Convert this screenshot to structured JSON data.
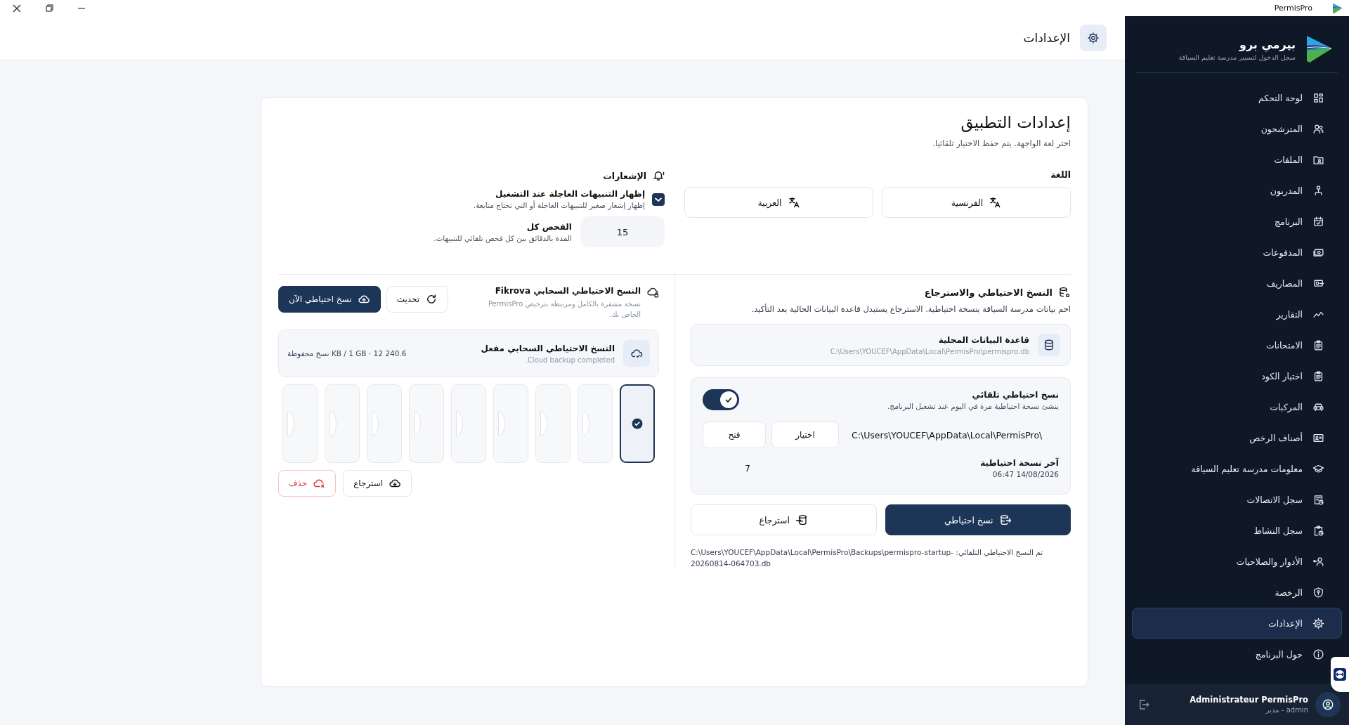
{
  "titlebar": {
    "app_name": "PermisPro"
  },
  "sidebar": {
    "brand": "بيرمي برو",
    "tagline": "سجل الدخول لتسيير مدرسة تعليم السياقة",
    "items": [
      {
        "label": "لوحة التحكم",
        "selected": false
      },
      {
        "label": "المترشحون",
        "selected": false
      },
      {
        "label": "الملفات",
        "selected": false
      },
      {
        "label": "المدربون",
        "selected": false
      },
      {
        "label": "البرنامج",
        "selected": false
      },
      {
        "label": "المدفوعات",
        "selected": false
      },
      {
        "label": "المصاريف",
        "selected": false
      },
      {
        "label": "التقارير",
        "selected": false
      },
      {
        "label": "الامتحانات",
        "selected": false
      },
      {
        "label": "اختبار الكود",
        "selected": false
      },
      {
        "label": "المركبات",
        "selected": false
      },
      {
        "label": "أصناف الرخص",
        "selected": false
      },
      {
        "label": "معلومات مدرسة تعليم السياقة",
        "selected": false
      },
      {
        "label": "سجل الاتصالات",
        "selected": false
      },
      {
        "label": "سجل النشاط",
        "selected": false
      },
      {
        "label": "الأدوار والصلاحيات",
        "selected": false
      },
      {
        "label": "الرخصة",
        "selected": false
      },
      {
        "label": "الإعدادات",
        "selected": true
      },
      {
        "label": "حول البرنامج",
        "selected": false
      }
    ],
    "user": {
      "name": "Administrateur PermisPro",
      "role": "admin - مدير"
    }
  },
  "header": {
    "title": "الإعدادات"
  },
  "settings": {
    "title": "إعدادات التطبيق",
    "subtitle": "اختر لغة الواجهة. يتم حفظ الاختيار تلقائيا.",
    "language": {
      "label": "اللغة",
      "options": [
        {
          "label": "الفرنسية"
        },
        {
          "label": "العربية"
        }
      ]
    },
    "notifications": {
      "title": "الإشعارات",
      "popup": {
        "label": "إظهار التنبيهات العاجلة عند التشغيل",
        "description": "إظهار إشعار صغير للتنبيهات العاجلة أو التي تحتاج متابعة.",
        "checked": true
      },
      "interval": {
        "value": "15",
        "label": "الفحص كل",
        "description": "المدة بالدقائق بين كل فحص تلقائي للتنبيهات."
      }
    },
    "backup": {
      "title": "النسخ الاحتياطي والاسترجاع",
      "description": "احم بيانات مدرسة السياقة بنسخة احتياطية. الاسترجاع يستبدل قاعدة البيانات الحالية بعد التأكيد.",
      "local_db": {
        "title": "قاعدة البيانات المحلية",
        "path": "C:\\Users\\YOUCEF\\AppData\\Local\\PermisPro\\permispro.db"
      },
      "auto": {
        "title": "نسخ احتياطي تلقائي",
        "description": "ينشئ نسخة احتياطية مرة في اليوم عند تشغيل البرنامج.",
        "on": true,
        "folder": "C:\\Users\\YOUCEF\\AppData\\Local\\PermisPro\\",
        "buttons": [
          "اختيار",
          "فتح"
        ],
        "last_label": "آخر نسخة احتياطية",
        "last_value": "14/08/2026 06:47",
        "number": "7"
      },
      "buttons": [
        {
          "label": "نسخ احتياطي",
          "kind": "primary"
        },
        {
          "label": "استرجاع",
          "kind": "secondary"
        }
      ],
      "message": "تم النسخ الاحتياطي التلقائي: C:\\Users\\YOUCEF\\AppData\\Local\\PermisPro\\Backups\\permispro-startup-20260814-064703.db"
    },
    "cloud": {
      "title": "النسخ الاحتياطي السحابي Fikrova",
      "description": "نسخة مشفرة بالكامل ومرتبطة بترخيص PermisPro الخاص بك.",
      "buttons": [
        {
          "label": "تحديث",
          "kind": "secondary"
        },
        {
          "label": "نسخ احتياطي الآن",
          "kind": "primary"
        }
      ],
      "status": {
        "title": "النسخ الاحتياطي السحابي مفعل",
        "detail": "Cloud backup completed.",
        "usage": "240.6 KB / 1 GB · 12 نسخ محفوظة"
      },
      "slots": [
        {
          "selected": true
        },
        {
          "selected": false
        },
        {
          "selected": false
        },
        {
          "selected": false
        },
        {
          "selected": false
        },
        {
          "selected": false
        },
        {
          "selected": false
        },
        {
          "selected": false
        },
        {
          "selected": false
        }
      ],
      "actions": [
        {
          "label": "استرجاع",
          "kind": "secondary"
        },
        {
          "label": "حذف",
          "kind": "danger"
        }
      ]
    }
  }
}
